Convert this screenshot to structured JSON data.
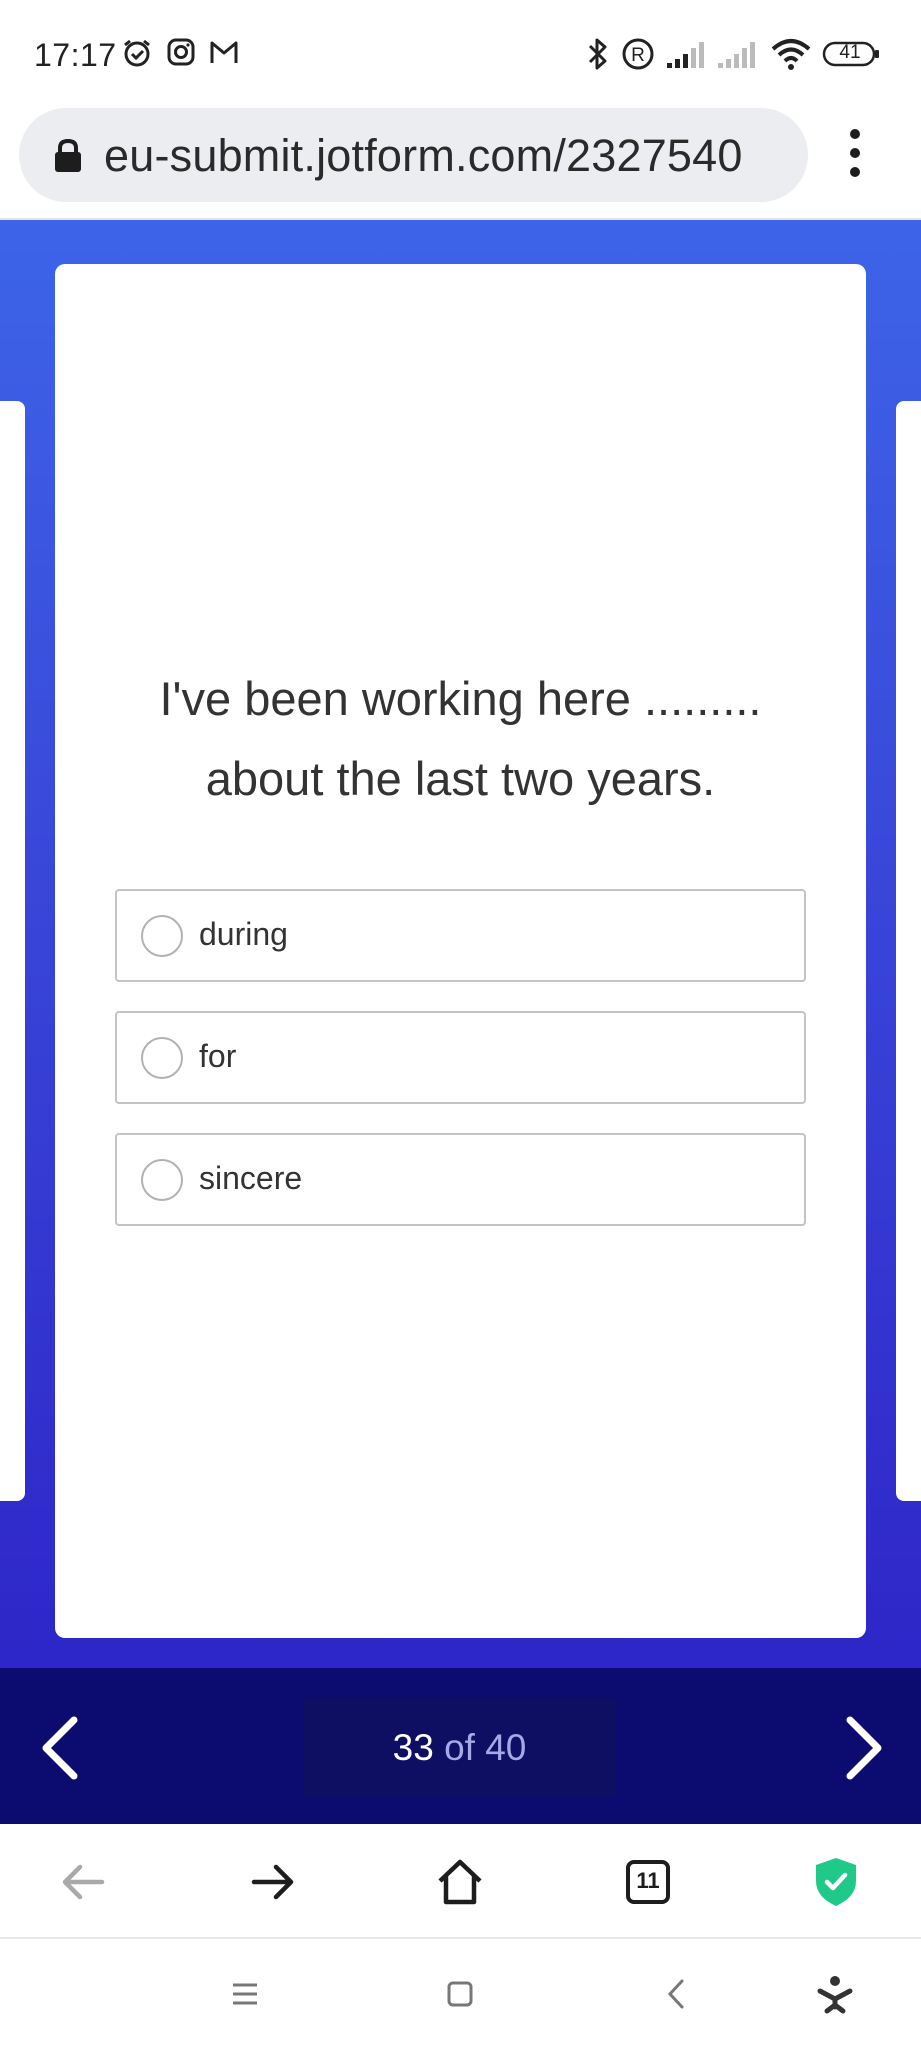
{
  "status_bar": {
    "time": "17:17",
    "battery": "41"
  },
  "browser": {
    "url": "eu-submit.jotform.com/2327540"
  },
  "form": {
    "question_line1": "I've been working here .........",
    "question_line2": "about the last two years.",
    "options": [
      {
        "label": "during"
      },
      {
        "label": "for"
      },
      {
        "label": "sincere"
      }
    ],
    "pager": {
      "current": "33",
      "of_text": "of 40"
    }
  },
  "browser_toolbar": {
    "tab_count": "11"
  },
  "colors": {
    "gradient_top": "#3d64e8",
    "gradient_bottom": "#2e26c8",
    "pager_bg": "#0c0c70",
    "shield_green": "#1fc98a"
  }
}
